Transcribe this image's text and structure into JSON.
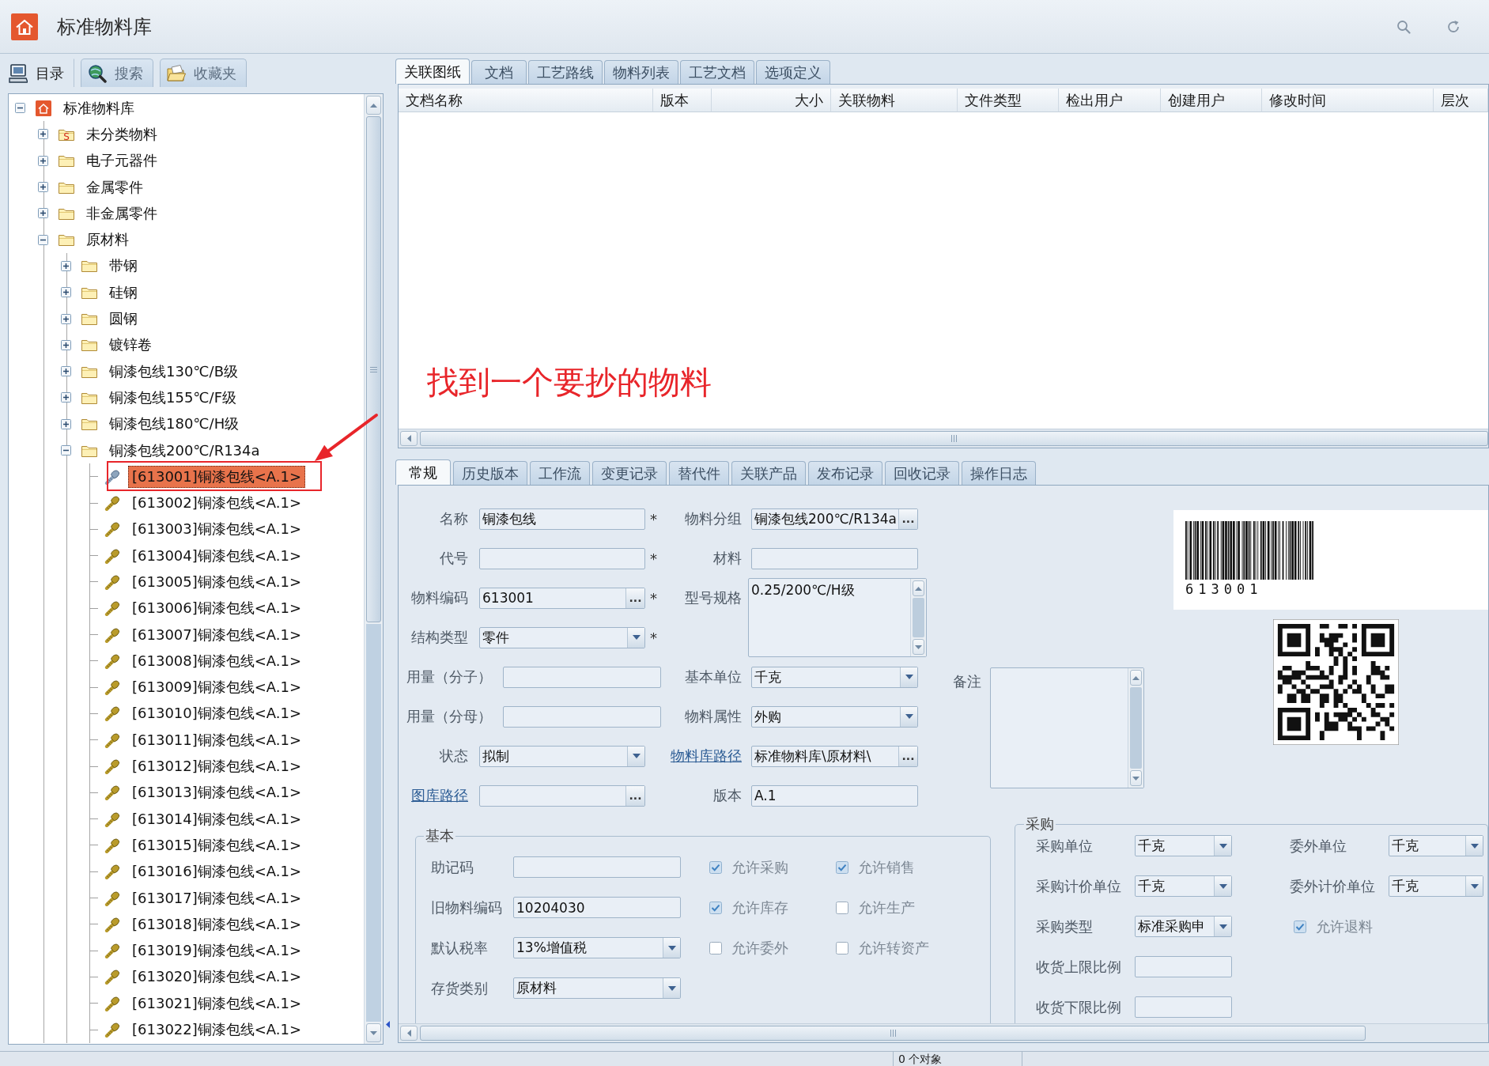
{
  "window": {
    "title": "标准物料库"
  },
  "nav_tabs": [
    {
      "label": "目录",
      "selected": true
    },
    {
      "label": "搜索",
      "selected": false
    },
    {
      "label": "收藏夹",
      "selected": false
    }
  ],
  "tree": [
    {
      "label": "标准物料库",
      "kind": "library",
      "expanded": true,
      "selected": false,
      "children": [
        {
          "label": "未分类物料",
          "kind": "folder",
          "badge": "S",
          "expanded": false,
          "selected": false
        },
        {
          "label": "电子元器件",
          "kind": "folder",
          "expanded": false,
          "selected": false
        },
        {
          "label": "金属零件",
          "kind": "folder",
          "expanded": false,
          "selected": false
        },
        {
          "label": "非金属零件",
          "kind": "folder",
          "expanded": false,
          "selected": false
        },
        {
          "label": "原材料",
          "kind": "folder",
          "expanded": true,
          "selected": false,
          "children": [
            {
              "label": "带钢",
              "kind": "folder",
              "expanded": false,
              "selected": false
            },
            {
              "label": "硅钢",
              "kind": "folder",
              "expanded": false,
              "selected": false
            },
            {
              "label": "圆钢",
              "kind": "folder",
              "expanded": false,
              "selected": false
            },
            {
              "label": "镀锌卷",
              "kind": "folder",
              "expanded": false,
              "selected": false
            },
            {
              "label": "铜漆包线130℃/B级",
              "kind": "folder",
              "expanded": false,
              "selected": false
            },
            {
              "label": "铜漆包线155℃/F级",
              "kind": "folder",
              "expanded": false,
              "selected": false
            },
            {
              "label": "铜漆包线180℃/H级",
              "kind": "folder",
              "expanded": false,
              "selected": false
            },
            {
              "label": "铜漆包线200℃/R134a",
              "kind": "folder",
              "expanded": true,
              "selected": false,
              "children": [
                {
                  "label": "[613001]铜漆包线<A.1>",
                  "kind": "part",
                  "selected": true
                },
                {
                  "label": "[613002]铜漆包线<A.1>",
                  "kind": "part",
                  "selected": false
                },
                {
                  "label": "[613003]铜漆包线<A.1>",
                  "kind": "part",
                  "selected": false
                },
                {
                  "label": "[613004]铜漆包线<A.1>",
                  "kind": "part",
                  "selected": false
                },
                {
                  "label": "[613005]铜漆包线<A.1>",
                  "kind": "part",
                  "selected": false
                },
                {
                  "label": "[613006]铜漆包线<A.1>",
                  "kind": "part",
                  "selected": false
                },
                {
                  "label": "[613007]铜漆包线<A.1>",
                  "kind": "part",
                  "selected": false
                },
                {
                  "label": "[613008]铜漆包线<A.1>",
                  "kind": "part",
                  "selected": false
                },
                {
                  "label": "[613009]铜漆包线<A.1>",
                  "kind": "part",
                  "selected": false
                },
                {
                  "label": "[613010]铜漆包线<A.1>",
                  "kind": "part",
                  "selected": false
                },
                {
                  "label": "[613011]铜漆包线<A.1>",
                  "kind": "part",
                  "selected": false
                },
                {
                  "label": "[613012]铜漆包线<A.1>",
                  "kind": "part",
                  "selected": false
                },
                {
                  "label": "[613013]铜漆包线<A.1>",
                  "kind": "part",
                  "selected": false
                },
                {
                  "label": "[613014]铜漆包线<A.1>",
                  "kind": "part",
                  "selected": false
                },
                {
                  "label": "[613015]铜漆包线<A.1>",
                  "kind": "part",
                  "selected": false
                },
                {
                  "label": "[613016]铜漆包线<A.1>",
                  "kind": "part",
                  "selected": false
                },
                {
                  "label": "[613017]铜漆包线<A.1>",
                  "kind": "part",
                  "selected": false
                },
                {
                  "label": "[613018]铜漆包线<A.1>",
                  "kind": "part",
                  "selected": false
                },
                {
                  "label": "[613019]铜漆包线<A.1>",
                  "kind": "part",
                  "selected": false
                },
                {
                  "label": "[613020]铜漆包线<A.1>",
                  "kind": "part",
                  "selected": false
                },
                {
                  "label": "[613021]铜漆包线<A.1>",
                  "kind": "part",
                  "selected": false
                },
                {
                  "label": "[613022]铜漆包线<A.1>",
                  "kind": "part",
                  "selected": false
                }
              ]
            }
          ]
        }
      ]
    }
  ],
  "annotation": {
    "text": "找到一个要抄的物料"
  },
  "document_tabs": [
    {
      "label": "关联图纸",
      "selected": true
    },
    {
      "label": "文档",
      "selected": false
    },
    {
      "label": "工艺路线",
      "selected": false
    },
    {
      "label": "物料列表",
      "selected": false
    },
    {
      "label": "工艺文档",
      "selected": false
    },
    {
      "label": "选项定义",
      "selected": false
    }
  ],
  "document_table": {
    "columns": [
      {
        "label": "文档名称",
        "kind": "text"
      },
      {
        "label": "版本",
        "kind": "text"
      },
      {
        "label": "大小",
        "kind": "number"
      },
      {
        "label": "关联物料",
        "kind": "text"
      },
      {
        "label": "文件类型",
        "kind": "text"
      },
      {
        "label": "检出用户",
        "kind": "text"
      },
      {
        "label": "创建用户",
        "kind": "text"
      },
      {
        "label": "修改时间",
        "kind": "text"
      },
      {
        "label": "层次",
        "kind": "text"
      }
    ]
  },
  "detail_tabs": [
    {
      "label": "常规",
      "selected": true
    },
    {
      "label": "历史版本",
      "selected": false
    },
    {
      "label": "工作流",
      "selected": false
    },
    {
      "label": "变更记录",
      "selected": false
    },
    {
      "label": "替代件",
      "selected": false
    },
    {
      "label": "关联产品",
      "selected": false
    },
    {
      "label": "发布记录",
      "selected": false
    },
    {
      "label": "回收记录",
      "selected": false
    },
    {
      "label": "操作日志",
      "selected": false
    }
  ],
  "general": {
    "left_fields": [
      {
        "label": "名称",
        "kind": "text",
        "value": "铜漆包线",
        "required_mark": "*"
      },
      {
        "label": "代号",
        "kind": "text",
        "required_mark": "*"
      },
      {
        "label": "物料编码",
        "kind": "browse",
        "value": "613001",
        "button": "...",
        "required_mark": "*"
      },
      {
        "label": "结构类型",
        "kind": "select",
        "value": "零件",
        "required_mark": "*"
      },
      {
        "label": "用量（分子）",
        "kind": "text"
      },
      {
        "label": "用量（分母）",
        "kind": "text"
      },
      {
        "label": "状态",
        "kind": "select",
        "value": "拟制"
      },
      {
        "label": "图库路径",
        "kind": "browse",
        "button": "...",
        "link": true
      }
    ],
    "middle_fields": [
      {
        "label": "物料分组",
        "kind": "browse",
        "value": "铜漆包线200℃/R134a",
        "button": "..."
      },
      {
        "label": "材料",
        "kind": "text"
      },
      {
        "label": "型号规格",
        "kind": "textarea",
        "value": "0.25/200℃/H级"
      },
      {
        "label": "基本单位",
        "kind": "select",
        "value": "千克"
      },
      {
        "label": "物料属性",
        "kind": "select",
        "value": "外购"
      },
      {
        "label": "物料库路径",
        "kind": "browse",
        "value": "标准物料库\\原材料\\",
        "button": "...",
        "link": true
      },
      {
        "label": "版本",
        "kind": "text",
        "value": "A.1"
      }
    ],
    "remark": {
      "label": "备注",
      "kind": "textarea"
    },
    "barcode": {
      "text": "613001"
    }
  },
  "basic": {
    "legend": "基本",
    "fields": [
      {
        "label": "助记码",
        "kind": "text"
      },
      {
        "label": "旧物料编码",
        "kind": "text",
        "value": "10204030"
      },
      {
        "label": "默认税率",
        "kind": "select",
        "value": "13%增值税"
      },
      {
        "label": "存货类别",
        "kind": "select",
        "value": "原材料"
      }
    ],
    "checkboxes": [
      {
        "label": "允许采购",
        "checked": true
      },
      {
        "label": "允许销售",
        "checked": true
      },
      {
        "label": "允许库存",
        "checked": true
      },
      {
        "label": "允许生产",
        "checked": false
      },
      {
        "label": "允许委外",
        "checked": false
      },
      {
        "label": "允许转资产",
        "checked": false
      }
    ]
  },
  "purchase": {
    "legend": "采购",
    "left_fields": [
      {
        "label": "采购单位",
        "kind": "select",
        "value": "千克"
      },
      {
        "label": "采购计价单位",
        "kind": "select",
        "value": "千克"
      },
      {
        "label": "采购类型",
        "kind": "select",
        "value": "标准采购申"
      },
      {
        "label": "收货上限比例",
        "kind": "text"
      },
      {
        "label": "收货下限比例",
        "kind": "text"
      }
    ],
    "right_fields": [
      {
        "label": "委外单位",
        "kind": "select",
        "value": "千克"
      },
      {
        "label": "委外计价单位",
        "kind": "select",
        "value": "千克"
      },
      {
        "label": "允许退料",
        "kind": "checkbox",
        "checked": true
      }
    ]
  },
  "status_bar": {
    "items": [
      "0 个对象"
    ]
  }
}
